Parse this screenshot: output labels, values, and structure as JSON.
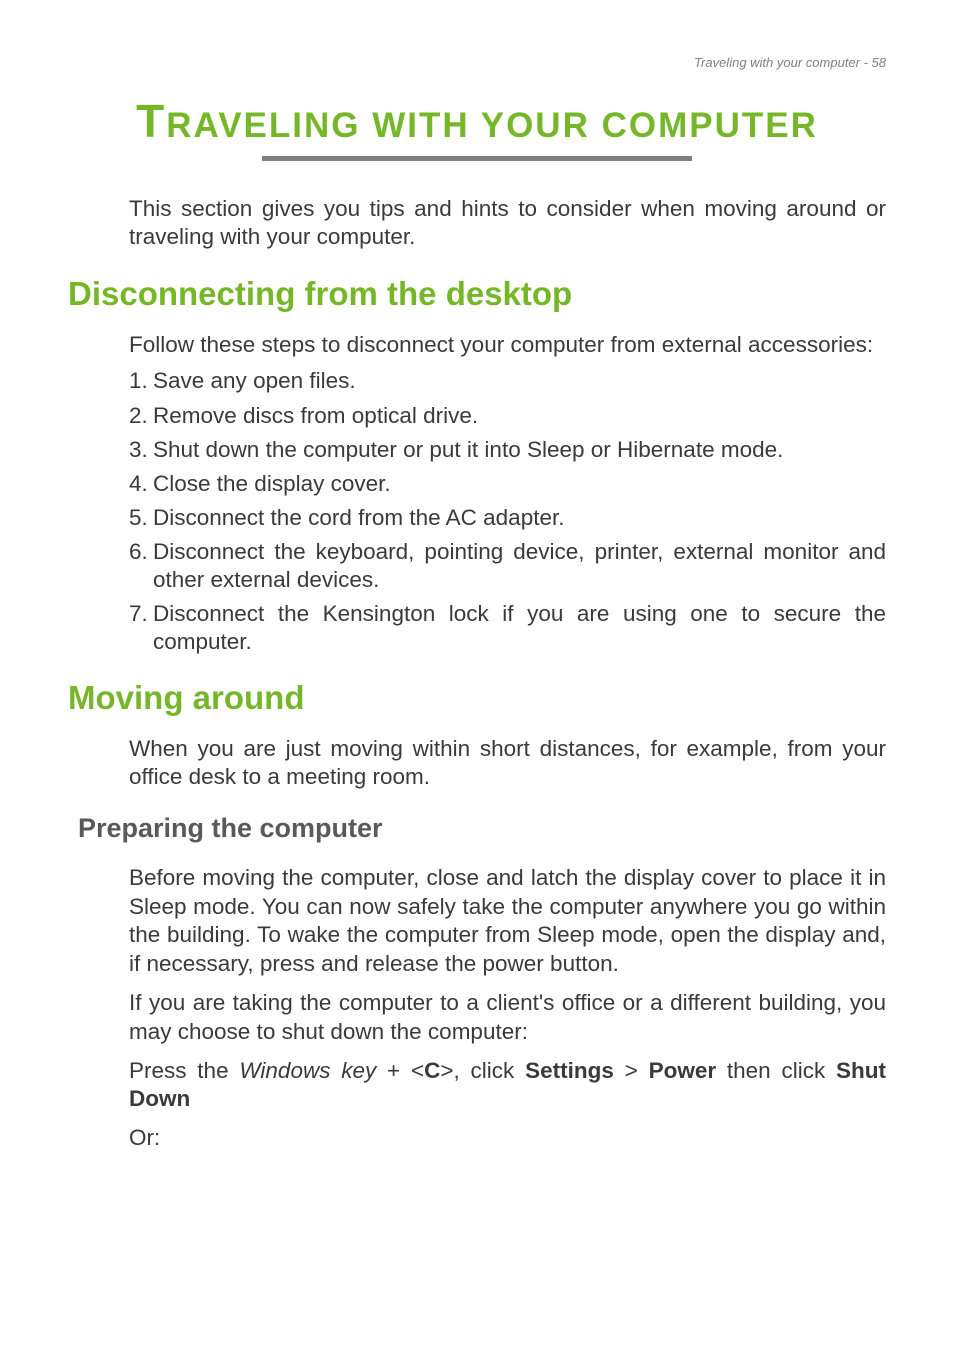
{
  "header": "Traveling with your computer - 58",
  "title": "RAVELING WITH YOUR COMPUTER",
  "title_prefix": "T",
  "intro": "This section gives you tips and hints to consider when moving around or traveling with your computer.",
  "section1": {
    "heading": "Disconnecting from the desktop",
    "intro": "Follow these steps to disconnect your computer from external accessories:",
    "items": [
      "Save any open files.",
      "Remove discs from optical drive.",
      "Shut down the computer or put it into Sleep or Hibernate mode.",
      "Close the display cover.",
      "Disconnect the cord from the AC adapter.",
      "Disconnect the keyboard, pointing device, printer, external monitor and other external devices.",
      "Disconnect the Kensington lock if you are using one to secure the computer."
    ]
  },
  "section2": {
    "heading": "Moving around",
    "intro": "When you are just moving within short distances, for example, from your office desk to a meeting room.",
    "sub": {
      "heading": "Preparing the computer",
      "p1": "Before moving the computer, close and latch the display cover to place it in Sleep mode. You can now safely take the computer anywhere you go within the building. To wake the computer from Sleep mode, open the display and, if necessary, press and release the power button.",
      "p2": "If you are taking the computer to a client's office or a different building, you may choose to shut down the computer:",
      "p3_pre": "Press the ",
      "p3_winkey": "Windows key",
      "p3_mid1": " + <",
      "p3_c": "C",
      "p3_mid2": ">, click ",
      "p3_settings": "Settings",
      "p3_mid3": " > ",
      "p3_power": "Power",
      "p3_mid4": " then click ",
      "p3_shutdown": "Shut Down",
      "p4": "Or:"
    }
  }
}
